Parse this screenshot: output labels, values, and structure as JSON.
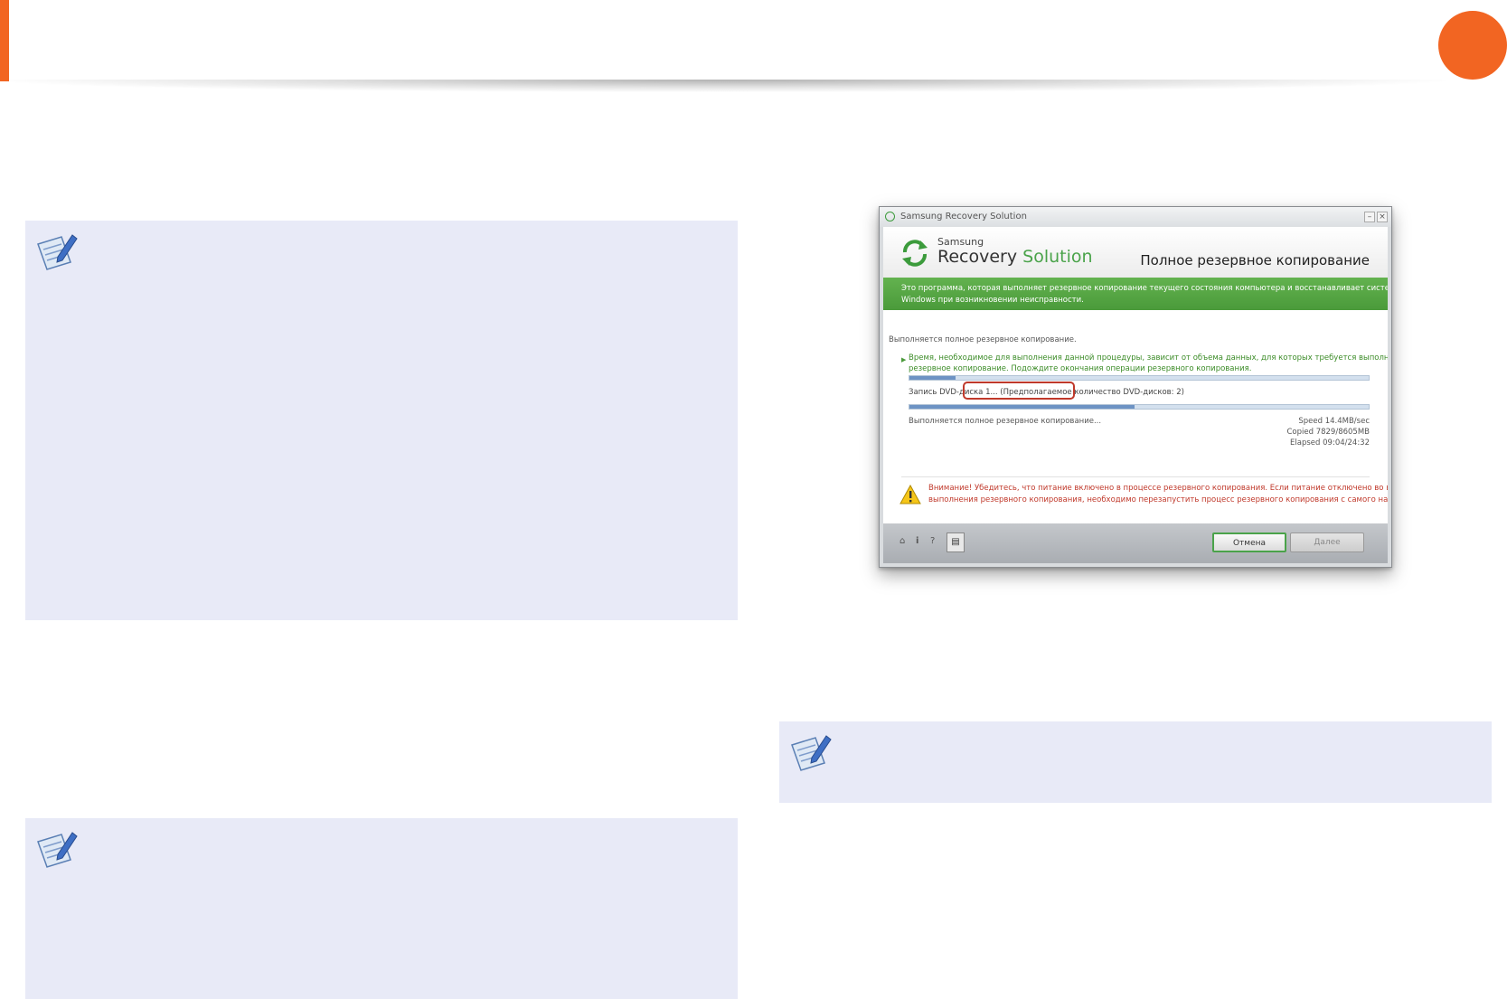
{
  "colors": {
    "accent": "#f26522",
    "note_background": "#e8eaf7",
    "brand_green": "#4aa34a",
    "warning_red": "#c0392b"
  },
  "icons": {
    "note": "note-pencil-icon",
    "logo": "recovery-arrows-icon",
    "warning": "warning-triangle-icon",
    "home": "home-icon",
    "info": "info-icon",
    "help": "help-icon",
    "log": "document-icon"
  },
  "dialog": {
    "window_title": "Samsung Recovery Solution",
    "brand_small": "Samsung",
    "brand_word1": "Recovery",
    "brand_word2": "Solution",
    "heading": "Полное резервное копирование",
    "banner": [
      "Это программа, которая выполняет резервное копирование текущего состояния компьютера и восстанавливает систему",
      "Windows при возникновении неисправности."
    ],
    "status": "Выполняется полное резервное копирование.",
    "info": [
      "Время, необходимое для выполнения данной процедуры, зависит от объема данных, для которых требуется выполнить",
      "резервное копирование. Подождите окончания операции резервного копирования."
    ],
    "progress_top": 0.1,
    "disc_status": "Запись DVD-диска 1... (Предполагаемое количество DVD-дисков: 2)",
    "progress_bottom": 0.49,
    "status2": "Выполняется полное резервное копирование...",
    "stats": [
      "Speed 14.4MB/sec",
      "Copied 7829/8605MB",
      "Elapsed 09:04/24:32"
    ],
    "warning": [
      "Внимание! Убедитесь, что питание включено в процессе резервного копирования. Если питание отключено во время",
      "выполнения резервного копирования, необходимо перезапустить процесс резервного копирования с самого начала."
    ],
    "footer": {
      "home": "⌂",
      "info": "i",
      "help": "?",
      "log": "▤",
      "cancel": "Отмена",
      "next": "Далее"
    }
  }
}
